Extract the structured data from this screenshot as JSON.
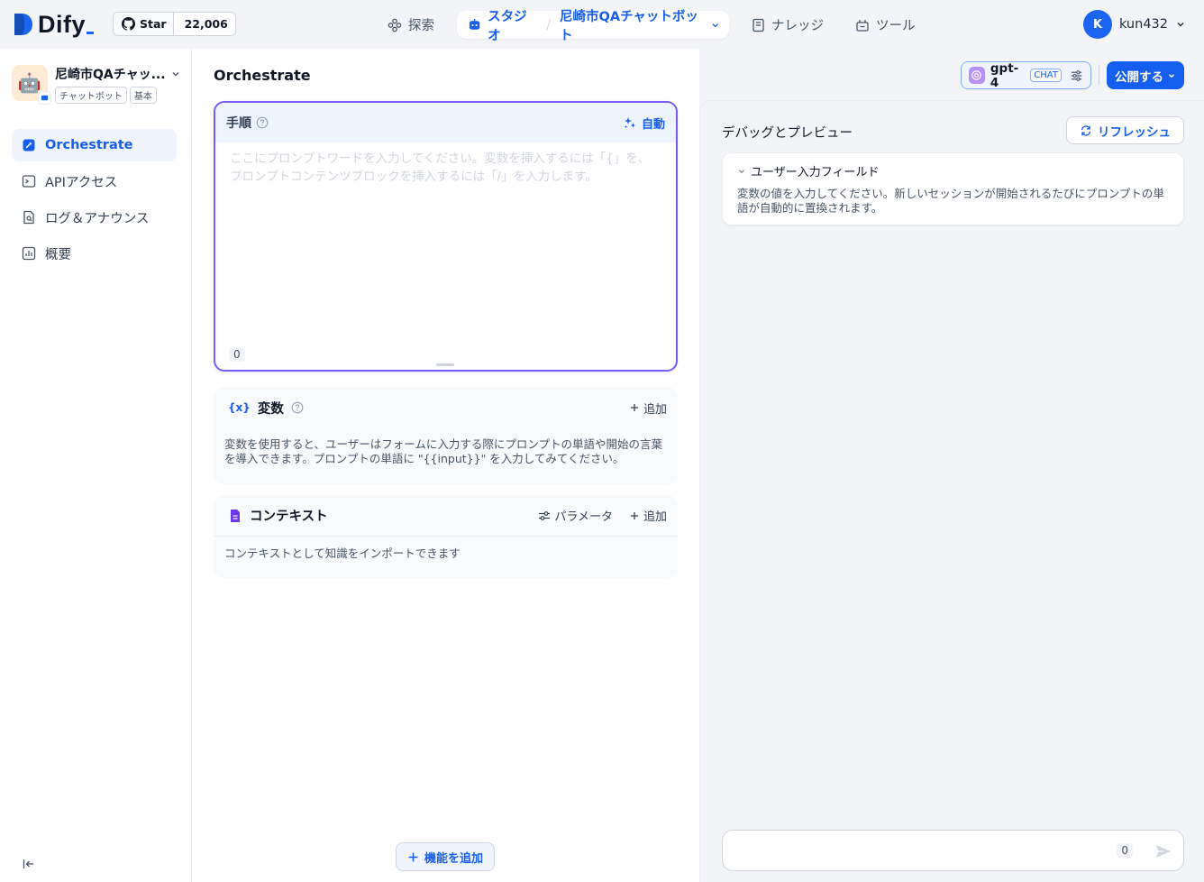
{
  "brand": {
    "name": "Dify"
  },
  "github": {
    "star_label": "Star",
    "count": "22,006"
  },
  "nav": {
    "explore": "探索",
    "studio": "スタジオ",
    "app_crumb": "尼崎市QAチャットボット",
    "knowledge": "ナレッジ",
    "tools": "ツール"
  },
  "user": {
    "initial": "K",
    "name": "kun432"
  },
  "app": {
    "name": "尼崎市QAチャッ...",
    "tags": [
      "チャットボット",
      "基本"
    ]
  },
  "sidebar": {
    "items": [
      {
        "label": "Orchestrate",
        "active": true
      },
      {
        "label": "APIアクセス"
      },
      {
        "label": "ログ＆アナウンス"
      },
      {
        "label": "概要"
      }
    ]
  },
  "main": {
    "title": "Orchestrate",
    "prompt": {
      "title": "手順",
      "auto_label": "自動",
      "placeholder": "ここにプロンプトワードを入力してください。変数を挿入するには「{」を、プロンプトコンテンツブロックを挿入するには「/」を入力します。",
      "char_count": "0"
    },
    "variables": {
      "icon_text": "{x}",
      "title": "変数",
      "add_label": "追加",
      "description": "変数を使用すると、ユーザーはフォームに入力する際にプロンプトの単語や開始の言葉を導入できます。プロンプトの単語に \"{{input}}\" を入力してみてください。"
    },
    "context": {
      "title": "コンテキスト",
      "params_label": "パラメータ",
      "add_label": "追加",
      "description": "コンテキストとして知識をインポートできます"
    },
    "add_feature_label": "機能を追加"
  },
  "toolbar": {
    "model": "gpt-4",
    "model_mode": "CHAT",
    "publish_label": "公開する"
  },
  "debug": {
    "title": "デバッグとプレビュー",
    "refresh_label": "リフレッシュ",
    "inputs_title": "ユーザー入力フィールド",
    "inputs_desc": "変数の値を入力してください。新しいセッションが開始されるたびにプロンプトの単語が自動的に置換されます。",
    "chat_count": "0"
  },
  "colors": {
    "accent": "#155eef",
    "prompt_border": "#7a5af8",
    "page_bg": "#f2f4f7"
  },
  "icons": [
    "github-icon",
    "explore-icon",
    "robot-icon",
    "book-icon",
    "tool-icon",
    "sparkle-icon",
    "help-icon",
    "variable-icon",
    "document-icon",
    "sliders-icon",
    "plus-icon",
    "refresh-icon",
    "send-icon",
    "collapse-sidebar-icon"
  ]
}
